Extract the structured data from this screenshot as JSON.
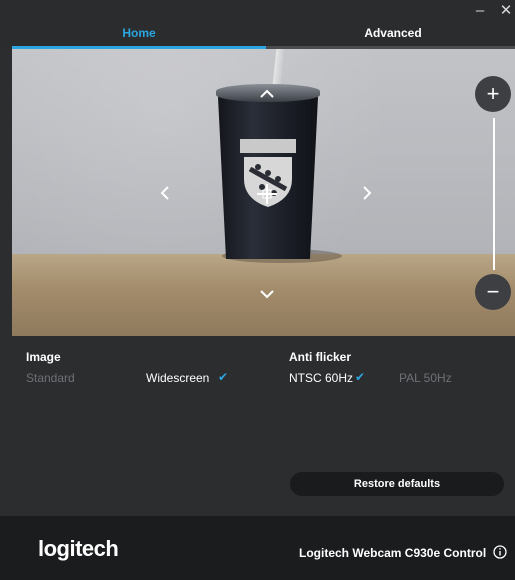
{
  "window": {
    "minimize_glyph": "–",
    "close_glyph": "✕"
  },
  "tabs": [
    {
      "label": "Home",
      "active": true
    },
    {
      "label": "Advanced",
      "active": false
    }
  ],
  "colors": {
    "accent": "#2ba6e0",
    "background": "#2b2d2f",
    "footer": "#1b1c1e"
  },
  "preview": {
    "controls": {
      "pan_up_icon": "chevron-up-icon",
      "pan_down_icon": "chevron-down-icon",
      "pan_left_icon": "chevron-left-icon",
      "pan_right_icon": "chevron-right-icon",
      "center_icon": "crosshair-icon",
      "zoom_in_label": "+",
      "zoom_out_label": "−"
    }
  },
  "image": {
    "title": "Image",
    "options": [
      {
        "label": "Standard",
        "selected": false
      },
      {
        "label": "Widescreen",
        "selected": true
      }
    ]
  },
  "anti_flicker": {
    "title": "Anti flicker",
    "options": [
      {
        "label": "NTSC 60Hz",
        "selected": true
      },
      {
        "label": "PAL 50Hz",
        "selected": false
      }
    ]
  },
  "check_glyph": "✔",
  "restore_label": "Restore defaults",
  "footer": {
    "logo": "logitech",
    "product": "Logitech Webcam C930e Control"
  }
}
